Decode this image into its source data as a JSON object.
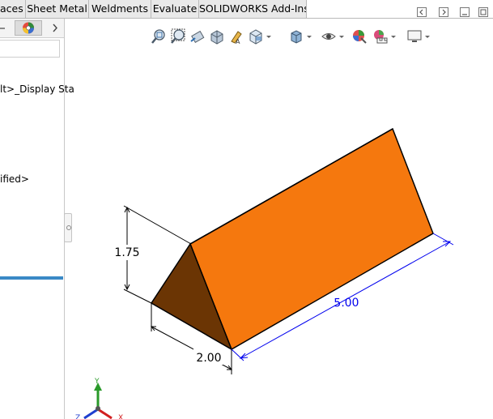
{
  "tabs": [
    "aces",
    "Sheet Metal",
    "Weldments",
    "Evaluate",
    "SOLIDWORKS Add-Ins"
  ],
  "feature_tree": {
    "display_state_text": "lt>_Display Sta",
    "material_text": "ified>"
  },
  "dimensions": {
    "height": "1.75",
    "width": "2.00",
    "length": "5.00"
  },
  "triad": {
    "y_label": "Y",
    "z_label": "Z",
    "x_label": "X"
  },
  "colors": {
    "prism_side": "#f5780e",
    "prism_end": "#6b3504",
    "dimension_driven": "#0000ee",
    "accent_blue": "#3a89c6"
  },
  "hud_icons": [
    "zoom-to-fit-icon",
    "zoom-to-area-icon",
    "previous-view-icon",
    "section-view-icon",
    "dynamic-annotation-icon",
    "view-orientation-icon",
    "display-style-icon",
    "hide-show-items-icon",
    "edit-appearance-icon",
    "apply-scene-icon",
    "view-settings-icon"
  ]
}
